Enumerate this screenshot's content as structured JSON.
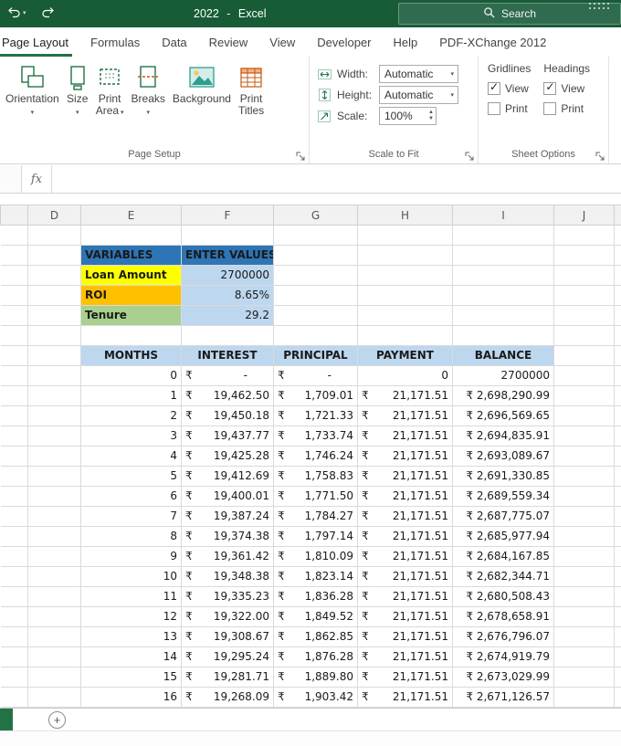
{
  "titlebar": {
    "title": "2022 - Excel",
    "search_label": "Search"
  },
  "ribbon": {
    "tabs": [
      {
        "label": "Page Layout",
        "active": true
      },
      {
        "label": "Formulas",
        "active": false
      },
      {
        "label": "Data",
        "active": false
      },
      {
        "label": "Review",
        "active": false
      },
      {
        "label": "View",
        "active": false
      },
      {
        "label": "Developer",
        "active": false
      },
      {
        "label": "Help",
        "active": false
      },
      {
        "label": "PDF-XChange 2012",
        "active": false
      }
    ],
    "page_setup": {
      "group_label": "Page Setup",
      "buttons": [
        {
          "label1": "Orientation",
          "label2": "",
          "caret": true,
          "icon": "orientation-icon"
        },
        {
          "label1": "Size",
          "label2": "",
          "caret": true,
          "icon": "size-icon"
        },
        {
          "label1": "Print",
          "label2": "Area",
          "caret": true,
          "icon": "print-area-icon"
        },
        {
          "label1": "Breaks",
          "label2": "",
          "caret": true,
          "icon": "breaks-icon"
        },
        {
          "label1": "Background",
          "label2": "",
          "caret": false,
          "icon": "background-icon"
        },
        {
          "label1": "Print",
          "label2": "Titles",
          "caret": false,
          "icon": "print-titles-icon"
        }
      ]
    },
    "scale_to_fit": {
      "group_label": "Scale to Fit",
      "fields": [
        {
          "label": "Width:",
          "value": "Automatic",
          "control": "dropdown",
          "icon": "width-icon"
        },
        {
          "label": "Height:",
          "value": "Automatic",
          "control": "dropdown",
          "icon": "height-icon"
        },
        {
          "label": "Scale:",
          "value": "100%",
          "control": "spinner",
          "icon": "scale-icon"
        }
      ]
    },
    "sheet_options": {
      "group_label": "Sheet Options",
      "columns": [
        {
          "title": "Gridlines",
          "options": [
            {
              "label": "View",
              "checked": true
            },
            {
              "label": "Print",
              "checked": false
            }
          ]
        },
        {
          "title": "Headings",
          "options": [
            {
              "label": "View",
              "checked": true
            },
            {
              "label": "Print",
              "checked": false
            }
          ]
        }
      ]
    }
  },
  "formula_bar": {
    "fx_label": "fx"
  },
  "sheet": {
    "column_headers": [
      "",
      "D",
      "E",
      "F",
      "G",
      "H",
      "I",
      "J",
      ""
    ],
    "variables": {
      "header_name": "VARIABLES",
      "header_value": "ENTER VALUES",
      "rows": [
        {
          "name": "Loan Amount",
          "value": "2700000",
          "color": "#FFFF00"
        },
        {
          "name": "ROI",
          "value": "8.65%",
          "color": "#FFC000"
        },
        {
          "name": "Tenure",
          "value": "29.2",
          "color": "#A9D08E"
        }
      ]
    },
    "table": {
      "headers": [
        "MONTHS",
        "INTEREST",
        "PRINCIPAL",
        "PAYMENT",
        "BALANCE"
      ],
      "currency_symbol": "₹",
      "rows": [
        {
          "month": "0",
          "interest": "-",
          "principal": "-",
          "payment": "0",
          "balance": "2700000",
          "interest_sym": true,
          "principal_sym": true,
          "payment_sym": false,
          "balance_sym": false,
          "dash": true
        },
        {
          "month": "1",
          "interest": "19,462.50",
          "principal": "1,709.01",
          "payment": "21,171.51",
          "balance": "2,698,290.99"
        },
        {
          "month": "2",
          "interest": "19,450.18",
          "principal": "1,721.33",
          "payment": "21,171.51",
          "balance": "2,696,569.65"
        },
        {
          "month": "3",
          "interest": "19,437.77",
          "principal": "1,733.74",
          "payment": "21,171.51",
          "balance": "2,694,835.91"
        },
        {
          "month": "4",
          "interest": "19,425.28",
          "principal": "1,746.24",
          "payment": "21,171.51",
          "balance": "2,693,089.67"
        },
        {
          "month": "5",
          "interest": "19,412.69",
          "principal": "1,758.83",
          "payment": "21,171.51",
          "balance": "2,691,330.85"
        },
        {
          "month": "6",
          "interest": "19,400.01",
          "principal": "1,771.50",
          "payment": "21,171.51",
          "balance": "2,689,559.34"
        },
        {
          "month": "7",
          "interest": "19,387.24",
          "principal": "1,784.27",
          "payment": "21,171.51",
          "balance": "2,687,775.07"
        },
        {
          "month": "8",
          "interest": "19,374.38",
          "principal": "1,797.14",
          "payment": "21,171.51",
          "balance": "2,685,977.94"
        },
        {
          "month": "9",
          "interest": "19,361.42",
          "principal": "1,810.09",
          "payment": "21,171.51",
          "balance": "2,684,167.85"
        },
        {
          "month": "10",
          "interest": "19,348.38",
          "principal": "1,823.14",
          "payment": "21,171.51",
          "balance": "2,682,344.71"
        },
        {
          "month": "11",
          "interest": "19,335.23",
          "principal": "1,836.28",
          "payment": "21,171.51",
          "balance": "2,680,508.43"
        },
        {
          "month": "12",
          "interest": "19,322.00",
          "principal": "1,849.52",
          "payment": "21,171.51",
          "balance": "2,678,658.91"
        },
        {
          "month": "13",
          "interest": "19,308.67",
          "principal": "1,862.85",
          "payment": "21,171.51",
          "balance": "2,676,796.07"
        },
        {
          "month": "14",
          "interest": "19,295.24",
          "principal": "1,876.28",
          "payment": "21,171.51",
          "balance": "2,674,919.79"
        },
        {
          "month": "15",
          "interest": "19,281.71",
          "principal": "1,889.80",
          "payment": "21,171.51",
          "balance": "2,673,029.99"
        },
        {
          "month": "16",
          "interest": "19,268.09",
          "principal": "1,903.42",
          "payment": "21,171.51",
          "balance": "2,671,126.57"
        }
      ]
    }
  },
  "sheet_bar": {
    "add_sheet_label": "+"
  },
  "colors": {
    "titlebar_green": "#185C37",
    "accent_green": "#217346",
    "header_blue": "#2E75B6",
    "light_blue": "#BDD7EE",
    "loan_yellow": "#FFFF00",
    "roi_orange": "#FFC000",
    "tenure_green": "#A9D08E"
  }
}
